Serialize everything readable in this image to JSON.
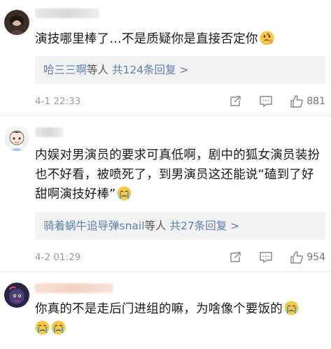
{
  "comments": [
    {
      "text": "演技哪里棒了…不是质疑你是直接否定你",
      "emoji": "thinking-face",
      "reply_user": "哈三三啊",
      "reply_mid": "等人",
      "reply_link": "共124条回复 >",
      "time": "4-1 22:33",
      "likes": "881"
    },
    {
      "text": "内娱对男演员的要求可真低啊，剧中的狐女演员装扮也不好看，被喷死了，到男演员这还能说“磕到了好甜啊演技好棒”",
      "emoji": "crying-face",
      "reply_user": "骑着蜗牛追导弹snail",
      "reply_mid": "等人",
      "reply_link": "共27条回复 >",
      "time": "4-2 01:29",
      "likes": "954"
    },
    {
      "text": "你真的不是走后门进组的嘛，为啥像个要饭的",
      "emoji": "crying-face"
    }
  ],
  "colors": {
    "link": "#5b7fa8",
    "meta": "#9a9a9a",
    "reply_bg": "#f2f2f2"
  }
}
